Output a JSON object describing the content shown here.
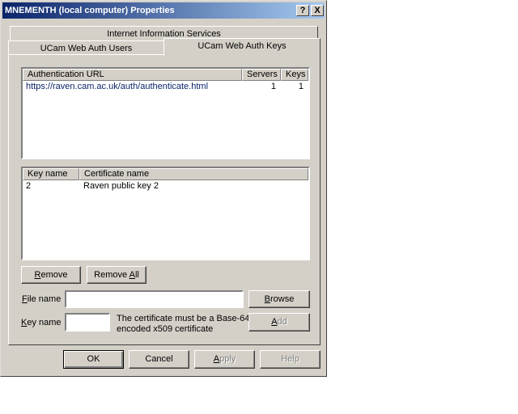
{
  "window": {
    "title": "MNEMENTH (local computer) Properties",
    "help_button": "?",
    "close_button": "X"
  },
  "tabs": {
    "back_row": "Internet Information Services",
    "front_row": [
      {
        "label": "UCam Web Auth Users"
      },
      {
        "label": "UCam Web Auth Keys"
      }
    ]
  },
  "url_list": {
    "headers": {
      "url": "Authentication URL",
      "servers": "Servers",
      "keys": "Keys"
    },
    "rows": [
      {
        "url": "https://raven.cam.ac.uk/auth/authenticate.html",
        "servers": "1",
        "keys": "1"
      }
    ]
  },
  "key_list": {
    "headers": {
      "key_name": "Key name",
      "certificate_name": "Certificate name"
    },
    "rows": [
      {
        "key_name": "2",
        "certificate_name": "Raven public key 2"
      }
    ]
  },
  "actions": {
    "remove": {
      "pre": "",
      "u": "R",
      "post": "emove"
    },
    "remove_all": {
      "pre": "Remove ",
      "u": "A",
      "post": "ll"
    }
  },
  "file_name": {
    "label": {
      "pre": "",
      "u": "F",
      "post": "ile name"
    },
    "value": "",
    "browse": {
      "pre": "",
      "u": "B",
      "post": "rowse"
    }
  },
  "key_name": {
    "label": {
      "pre": "",
      "u": "K",
      "post": "ey name"
    },
    "value": "",
    "note": "The certificate must be a Base-64 encoded x509 certificate",
    "add": {
      "pre": "",
      "u": "A",
      "post": "dd"
    }
  },
  "footer": {
    "ok": "OK",
    "cancel": "Cancel",
    "apply": {
      "pre": "",
      "u": "A",
      "post": "pply"
    },
    "help": "Help"
  }
}
